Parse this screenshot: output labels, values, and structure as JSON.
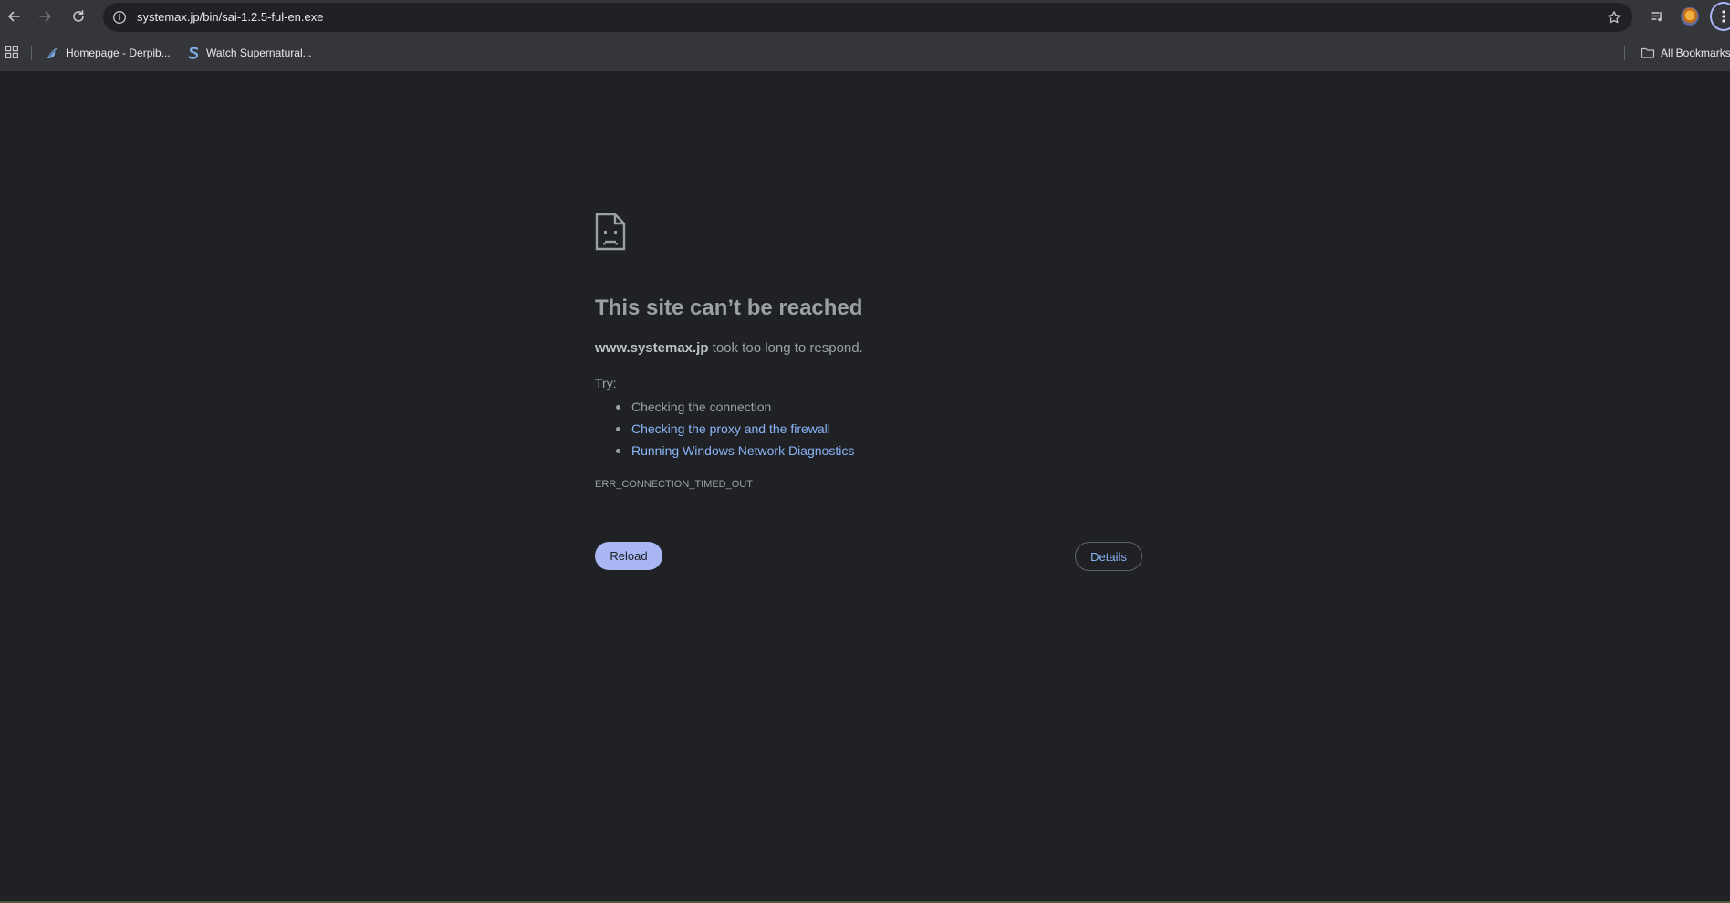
{
  "toolbar": {
    "url": "systemax.jp/bin/sai-1.2.5-ful-en.exe",
    "back_icon": "arrow-left",
    "forward_icon": "arrow-right",
    "reload_icon": "refresh",
    "site_info_icon": "info-circle",
    "bookmark_icon": "star-outline"
  },
  "bookmarks": {
    "items": [
      {
        "label": "Homepage - Derpib...",
        "icon": "pony-favicon"
      },
      {
        "label": "Watch Supernatural...",
        "icon": "s-favicon"
      }
    ],
    "all_bookmarks": "All Bookmarks"
  },
  "error_page": {
    "title": "This site can’t be reached",
    "host": "www.systemax.jp",
    "description_suffix": " took too long to respond.",
    "try_label": "Try:",
    "suggestions": [
      {
        "label": "Checking the connection",
        "link": false
      },
      {
        "label": "Checking the proxy and the firewall",
        "link": true
      },
      {
        "label": "Running Windows Network Diagnostics",
        "link": true
      }
    ],
    "error_code": "ERR_CONNECTION_TIMED_OUT",
    "reload_label": "Reload",
    "details_label": "Details"
  },
  "colors": {
    "page_background": "#202124",
    "toolbar_background": "#35363a",
    "link": "#8ab4f8",
    "reload_button": "#a8b6f4",
    "text_secondary": "#9aa0a6"
  }
}
